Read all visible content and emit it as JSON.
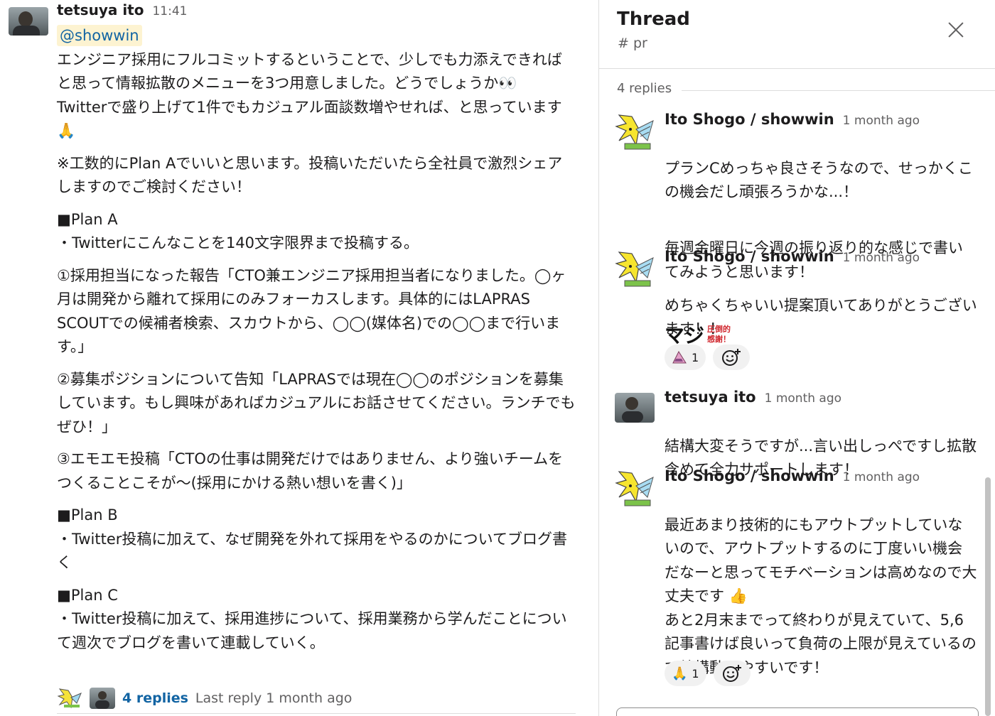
{
  "main": {
    "author": "tetsuya ito",
    "time": "11:41",
    "mention": "@showwin",
    "paragraphs": [
      "エンジニア採用にフルコミットするということで、少しでも力添えできればと思って情報拡散のメニューを3つ用意しました。どうでしょうか👀\nTwitterで盛り上げて1件でもカジュアル面談数増やせれば、と思っています🙏",
      "※工数的にPlan Aでいいと思います。投稿いただいたら全社員で激烈シェアしますのでご検討ください！",
      "■Plan A\n・Twitterにこんなことを140文字限界まで投稿する。",
      "①採用担当になった報告「CTO兼エンジニア採用担当者になりました。◯ヶ月は開発から離れて採用にのみフォーカスします。具体的にはLAPRAS SCOUTでの候補者検索、スカウトから、◯◯(媒体名)での◯◯まで行います。」",
      "②募集ポジションについて告知「LAPRASでは現在◯◯のポジションを募集しています。もし興味があればカジュアルにお話させてください。ランチでもぜひ！」",
      "③エモエモ投稿「CTOの仕事は開発だけではありません、より強いチームをつくることこそが〜(採用にかける熱い想いを書く)」",
      "■Plan B\n・Twitter投稿に加えて、なぜ開発を外れて採用をやるのかについてブログ書く",
      "■Plan C\n・Twitter投稿に加えて、採用進捗について、採用業務から学んだことについて週次でブログを書いて連載していく。"
    ],
    "replies_link": "4 replies",
    "last_reply": "Last reply 1 month ago"
  },
  "thread": {
    "title": "Thread",
    "channel": "# pr",
    "replies_count": "4 replies",
    "replies": [
      {
        "author": "Ito Shogo / showwin",
        "time": "1 month ago",
        "paragraphs": [
          "プランCめっちゃ良さそうなので、せっかくこの機会だし頑張ろうかな...！",
          "毎週金曜日に今週の振り返り的な感じで書いてみようと思います！"
        ]
      },
      {
        "author": "Ito Shogo / showwin",
        "time": "1 month ago",
        "paragraphs": [
          "めちゃくちゃいい提案頂いてありがとうございます！！"
        ],
        "sticker_big": "マジ",
        "sticker_small": "圧倒的\n感謝！",
        "reaction_count": "1"
      },
      {
        "author": "tetsuya ito",
        "time": "1 month ago",
        "paragraphs": [
          "結構大変そうですが...言い出しっぺですし拡散含めて全力サポートします！"
        ]
      },
      {
        "author": "Ito Shogo / showwin",
        "time": "1 month ago",
        "paragraphs": [
          "最近あまり技術的にもアウトプットしていないので、アウトプットするのに丁度いい機会だなーと思ってモチベーションは高めなので大丈夫です 👍\nあと2月末までって終わりが見えていて、5,6記事書けば良いって負荷の上限が見えているので結構動きやすいです！"
        ],
        "reaction_emoji": "🙏",
        "reaction_count": "1"
      }
    ]
  },
  "colors": {
    "link": "#1264a3",
    "mention_bg": "#fdf3d1",
    "muted": "#616061",
    "border": "#dddddd"
  },
  "icons": [
    "close-icon",
    "add-reaction-icon",
    "user-avatar",
    "bot-avatar"
  ]
}
